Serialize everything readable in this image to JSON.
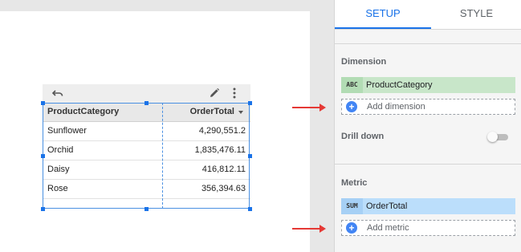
{
  "canvas": {
    "chart": {
      "columns": [
        "ProductCategory",
        "OrderTotal"
      ],
      "sort_indicator": "descending",
      "rows": [
        {
          "category": "Sunflower",
          "total": "4,290,551.2"
        },
        {
          "category": "Orchid",
          "total": "1,835,476.11"
        },
        {
          "category": "Daisy",
          "total": "416,812.11"
        },
        {
          "category": "Rose",
          "total": "356,394.63"
        }
      ],
      "toolbar_icons": [
        "undo-icon",
        "pencil-icon",
        "more-vert-icon"
      ]
    }
  },
  "panel": {
    "tabs": [
      {
        "label": "SETUP",
        "active": true
      },
      {
        "label": "STYLE",
        "active": false
      }
    ],
    "dimension": {
      "title": "Dimension",
      "field": {
        "type_tag": "ABC",
        "label": "ProductCategory"
      },
      "add_label": "Add dimension"
    },
    "drill_down": {
      "label": "Drill down",
      "enabled": false
    },
    "metric": {
      "title": "Metric",
      "field": {
        "type_tag": "SUM",
        "label": "OrderTotal"
      },
      "add_label": "Add metric"
    }
  },
  "colors": {
    "accent": "#1a73e8",
    "annotation_arrow": "#e53935",
    "dimension_chip": "#c8e6c9",
    "metric_chip": "#bbdefb"
  }
}
